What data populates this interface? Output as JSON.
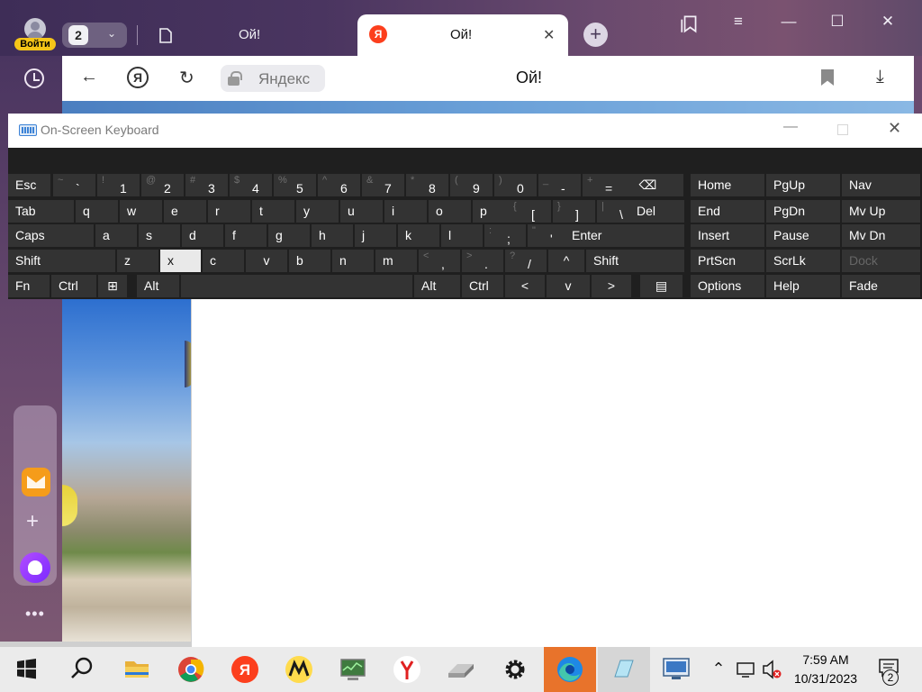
{
  "browser": {
    "login_label": "Войти",
    "tab_count": "2",
    "tabs": [
      {
        "title": "Ой!"
      },
      {
        "title": "Ой!"
      }
    ],
    "ya_logo": "Я",
    "address": {
      "domain": "Яндекс",
      "page_title": "Ой!"
    }
  },
  "osk": {
    "title": "On-Screen Keyboard",
    "rows": [
      [
        {
          "label": "Esc"
        },
        {
          "shift": "~",
          "main": "`"
        },
        {
          "shift": "!",
          "main": "1"
        },
        {
          "shift": "@",
          "main": "2"
        },
        {
          "shift": "#",
          "main": "3"
        },
        {
          "shift": "$",
          "main": "4"
        },
        {
          "shift": "%",
          "main": "5"
        },
        {
          "shift": "^",
          "main": "6"
        },
        {
          "shift": "&",
          "main": "7"
        },
        {
          "shift": "*",
          "main": "8"
        },
        {
          "shift": "(",
          "main": "9"
        },
        {
          "shift": ")",
          "main": "0"
        },
        {
          "shift": "_",
          "main": "-"
        },
        {
          "shift": "+",
          "main": "="
        },
        {
          "label": "⌫"
        },
        {
          "label": "Home"
        },
        {
          "label": "PgUp"
        },
        {
          "label": "Nav"
        }
      ],
      [
        {
          "label": "Tab"
        },
        {
          "label": "q"
        },
        {
          "label": "w"
        },
        {
          "label": "e"
        },
        {
          "label": "r"
        },
        {
          "label": "t"
        },
        {
          "label": "y"
        },
        {
          "label": "u"
        },
        {
          "label": "i"
        },
        {
          "label": "o"
        },
        {
          "label": "p"
        },
        {
          "shift": "{",
          "main": "["
        },
        {
          "shift": "}",
          "main": "]"
        },
        {
          "shift": "|",
          "main": "\\"
        },
        {
          "label": "Del"
        },
        {
          "label": "End"
        },
        {
          "label": "PgDn"
        },
        {
          "label": "Mv Up"
        }
      ],
      [
        {
          "label": "Caps"
        },
        {
          "label": "a"
        },
        {
          "label": "s"
        },
        {
          "label": "d"
        },
        {
          "label": "f"
        },
        {
          "label": "g"
        },
        {
          "label": "h"
        },
        {
          "label": "j"
        },
        {
          "label": "k"
        },
        {
          "label": "l"
        },
        {
          "shift": ":",
          "main": ";"
        },
        {
          "shift": "\"",
          "main": "'"
        },
        {
          "label": "Enter"
        },
        {
          "label": "Insert"
        },
        {
          "label": "Pause"
        },
        {
          "label": "Mv Dn"
        }
      ],
      [
        {
          "label": "Shift"
        },
        {
          "label": "z"
        },
        {
          "label": "x"
        },
        {
          "label": "c"
        },
        {
          "label": "v"
        },
        {
          "label": "b"
        },
        {
          "label": "n"
        },
        {
          "label": "m"
        },
        {
          "shift": "<",
          "main": ","
        },
        {
          "shift": ">",
          "main": "."
        },
        {
          "shift": "?",
          "main": "/"
        },
        {
          "label": "^"
        },
        {
          "label": "Shift"
        },
        {
          "label": "PrtScn"
        },
        {
          "label": "ScrLk"
        },
        {
          "label": "Dock"
        }
      ],
      [
        {
          "label": "Fn"
        },
        {
          "label": "Ctrl"
        },
        {
          "label": "⊞"
        },
        {
          "label": "Alt"
        },
        {
          "label": ""
        },
        {
          "label": "Alt"
        },
        {
          "label": "Ctrl"
        },
        {
          "label": "<"
        },
        {
          "label": "v"
        },
        {
          "label": ">"
        },
        {
          "label": "▤"
        },
        {
          "label": "Options"
        },
        {
          "label": "Help"
        },
        {
          "label": "Fade"
        }
      ]
    ],
    "highlighted_key": "x",
    "disabled_key": "Dock"
  },
  "taskbar": {
    "time": "7:59 AM",
    "date": "10/31/2023",
    "notifications": "2"
  },
  "colors": {
    "tabstrip": "#4a3560",
    "osk_bg": "#1f1f1f",
    "osk_key": "#333333",
    "yandex_red": "#fc3f1d",
    "taskbar": "#ebebeb"
  }
}
